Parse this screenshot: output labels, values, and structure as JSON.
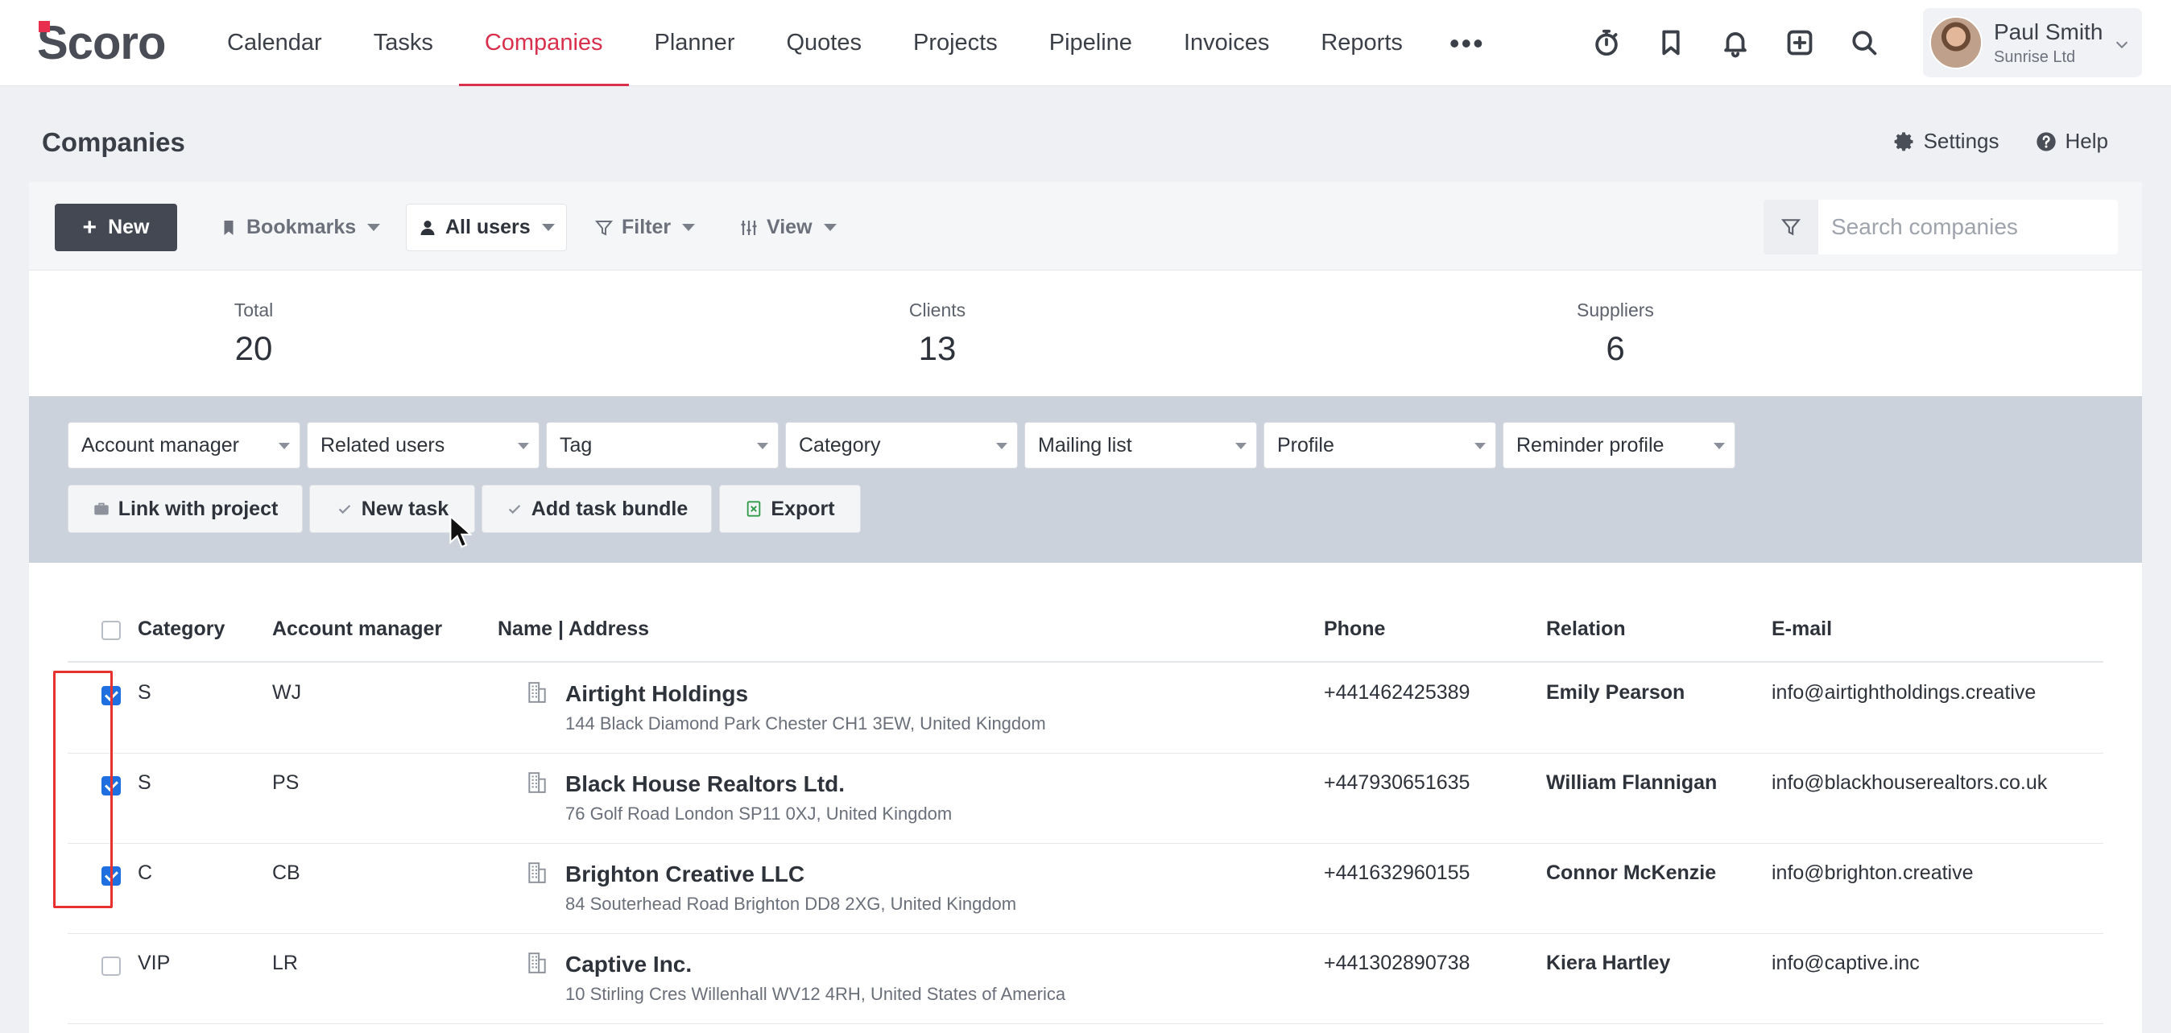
{
  "app": {
    "logo": "Scoro",
    "nav": [
      "Calendar",
      "Tasks",
      "Companies",
      "Planner",
      "Quotes",
      "Projects",
      "Pipeline",
      "Invoices",
      "Reports"
    ],
    "active_nav": "Companies",
    "more": "•••",
    "icons": [
      "timer-icon",
      "bookmark-icon",
      "bell-icon",
      "add-icon",
      "search-icon"
    ],
    "user": {
      "name": "Paul Smith",
      "company": "Sunrise Ltd"
    }
  },
  "page": {
    "title": "Companies",
    "settings_label": "Settings",
    "help_label": "Help"
  },
  "toolbar": {
    "new_label": "New",
    "bookmarks_label": "Bookmarks",
    "users_label": "All users",
    "filter_label": "Filter",
    "view_label": "View",
    "search_placeholder": "Search companies"
  },
  "stats": [
    {
      "label": "Total",
      "value": "20"
    },
    {
      "label": "Clients",
      "value": "13"
    },
    {
      "label": "Suppliers",
      "value": "6"
    }
  ],
  "bulk": {
    "selects": [
      "Account manager",
      "Related users",
      "Tag",
      "Category",
      "Mailing list",
      "Profile",
      "Reminder profile"
    ],
    "actions": [
      "Link with project",
      "New task",
      "Add task bundle",
      "Export"
    ]
  },
  "table": {
    "headers": [
      "Category",
      "Account manager",
      "Name | Address",
      "Phone",
      "Relation",
      "E-mail"
    ],
    "rows": [
      {
        "checked": true,
        "category": "S",
        "manager": "WJ",
        "name": "Airtight Holdings",
        "address": "144 Black Diamond Park Chester CH1 3EW, United Kingdom",
        "phone": "+441462425389",
        "relation": "Emily Pearson",
        "email": "info@airtightholdings.creative"
      },
      {
        "checked": true,
        "category": "S",
        "manager": "PS",
        "name": "Black House Realtors Ltd.",
        "address": "76 Golf Road London SP11 0XJ, United Kingdom",
        "phone": "+447930651635",
        "relation": "William Flannigan",
        "email": "info@blackhouserealtors.co.uk"
      },
      {
        "checked": true,
        "category": "C",
        "manager": "CB",
        "name": "Brighton Creative LLC",
        "address": "84 Souterhead Road Brighton DD8 2XG, United Kingdom",
        "phone": "+441632960155",
        "relation": "Connor McKenzie",
        "email": "info@brighton.creative"
      },
      {
        "checked": false,
        "category": "VIP",
        "manager": "LR",
        "name": "Captive Inc.",
        "address": "10 Stirling Cres Willenhall WV12 4RH, United States of America",
        "phone": "+441302890738",
        "relation": "Kiera Hartley",
        "email": "info@captive.inc"
      }
    ]
  },
  "colors": {
    "accent": "#d9304c",
    "checkbox": "#1f6fe0",
    "highlight": "#e8302f",
    "panel": "#ccd2dc"
  }
}
